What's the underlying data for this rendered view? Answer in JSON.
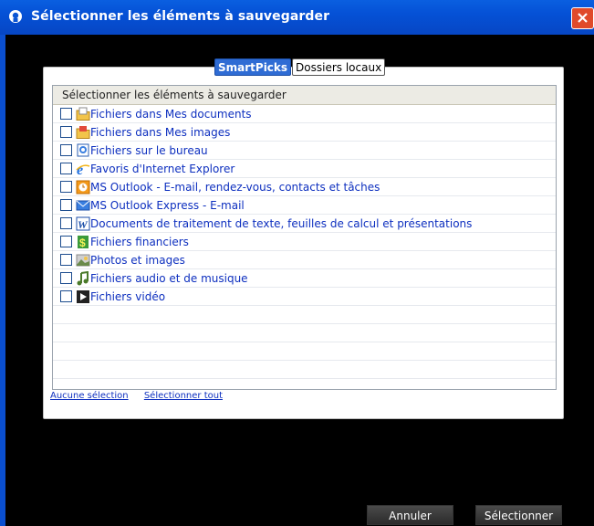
{
  "window": {
    "title": "Sélectionner les éléments à sauvegarder"
  },
  "tabs": [
    {
      "label": "SmartPicks",
      "active": true
    },
    {
      "label": "Dossiers locaux",
      "active": false
    }
  ],
  "list": {
    "header": "Sélectionner les éléments à sauvegarder",
    "items": [
      {
        "label": "Fichiers dans Mes documents",
        "icon": "folder-documents-icon",
        "checked": false
      },
      {
        "label": "Fichiers dans Mes images",
        "icon": "folder-images-icon",
        "checked": false
      },
      {
        "label": "Fichiers sur le bureau",
        "icon": "desktop-icon",
        "checked": false
      },
      {
        "label": "Favoris d'Internet Explorer",
        "icon": "internet-explorer-icon",
        "checked": false
      },
      {
        "label": "MS Outlook - E-mail, rendez-vous, contacts et tâches",
        "icon": "outlook-icon",
        "checked": false
      },
      {
        "label": "MS Outlook Express - E-mail",
        "icon": "outlook-express-icon",
        "checked": false
      },
      {
        "label": "Documents de traitement de texte, feuilles de calcul et présentations",
        "icon": "word-document-icon",
        "checked": false
      },
      {
        "label": "Fichiers financiers",
        "icon": "dollar-icon",
        "checked": false
      },
      {
        "label": "Photos et images",
        "icon": "photo-icon",
        "checked": false
      },
      {
        "label": "Fichiers audio et de musique",
        "icon": "music-note-icon",
        "checked": false
      },
      {
        "label": "Fichiers vidéo",
        "icon": "video-play-icon",
        "checked": false
      }
    ]
  },
  "links": {
    "select_none": "Aucune sélection",
    "select_all": "Sélectionner tout"
  },
  "buttons": {
    "cancel": "Annuler",
    "select": "Sélectionner"
  }
}
